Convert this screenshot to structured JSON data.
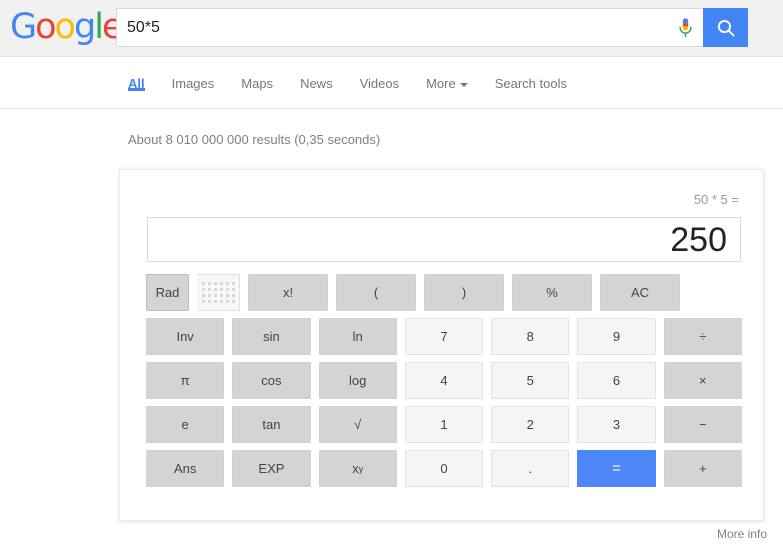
{
  "header": {
    "logo": {
      "letters": [
        {
          "char": "G",
          "color": "#4285F4"
        },
        {
          "char": "o",
          "color": "#EA4335"
        },
        {
          "char": "o",
          "color": "#FBBC05"
        },
        {
          "char": "g",
          "color": "#4285F4"
        },
        {
          "char": "l",
          "color": "#34A853"
        },
        {
          "char": "e",
          "color": "#EA4335"
        }
      ],
      "text": "Google"
    },
    "search": {
      "value": "50*5",
      "placeholder": "",
      "mic_icon": "microphone-icon",
      "search_icon": "search-icon",
      "button_color": "#4285F4"
    }
  },
  "nav": {
    "items": [
      {
        "label": "All",
        "active": true
      },
      {
        "label": "Images",
        "active": false
      },
      {
        "label": "Maps",
        "active": false
      },
      {
        "label": "News",
        "active": false
      },
      {
        "label": "Videos",
        "active": false
      },
      {
        "label": "More",
        "active": false,
        "has_caret": true
      },
      {
        "label": "Search tools",
        "active": false
      }
    ],
    "active_color": "#4285F4"
  },
  "results": {
    "stats": "About 8 010 000 000 results (0,35 seconds)"
  },
  "calculator": {
    "expression": "50 * 5 =",
    "result": "250",
    "equals_color": "#4d86f7",
    "rows": [
      [
        {
          "label": "Rad",
          "type": "toggle-on"
        },
        {
          "label": "",
          "type": "toggle-off",
          "icon": "dot-grid-icon"
        },
        {
          "label": "x!",
          "type": "fn"
        },
        {
          "label": "(",
          "type": "fn"
        },
        {
          "label": ")",
          "type": "fn"
        },
        {
          "label": "%",
          "type": "fn"
        },
        {
          "label": "AC",
          "type": "fn"
        }
      ],
      [
        {
          "label": "Inv",
          "type": "fn"
        },
        {
          "label": "sin",
          "type": "fn"
        },
        {
          "label": "ln",
          "type": "fn"
        },
        {
          "label": "7",
          "type": "num"
        },
        {
          "label": "8",
          "type": "num"
        },
        {
          "label": "9",
          "type": "num"
        },
        {
          "label": "÷",
          "type": "fn"
        }
      ],
      [
        {
          "label": "π",
          "type": "fn"
        },
        {
          "label": "cos",
          "type": "fn"
        },
        {
          "label": "log",
          "type": "fn"
        },
        {
          "label": "4",
          "type": "num"
        },
        {
          "label": "5",
          "type": "num"
        },
        {
          "label": "6",
          "type": "num"
        },
        {
          "label": "×",
          "type": "fn"
        }
      ],
      [
        {
          "label": "e",
          "type": "fn"
        },
        {
          "label": "tan",
          "type": "fn"
        },
        {
          "label": "√",
          "type": "fn"
        },
        {
          "label": "1",
          "type": "num"
        },
        {
          "label": "2",
          "type": "num"
        },
        {
          "label": "3",
          "type": "num"
        },
        {
          "label": "−",
          "type": "fn"
        }
      ],
      [
        {
          "label": "Ans",
          "type": "fn"
        },
        {
          "label": "EXP",
          "type": "fn"
        },
        {
          "label": "x",
          "sup": "y",
          "type": "fn"
        },
        {
          "label": "0",
          "type": "num"
        },
        {
          "label": ".",
          "type": "num"
        },
        {
          "label": "=",
          "type": "eq"
        },
        {
          "label": "+",
          "type": "fn"
        }
      ]
    ]
  },
  "footer": {
    "more_info": "More info"
  }
}
